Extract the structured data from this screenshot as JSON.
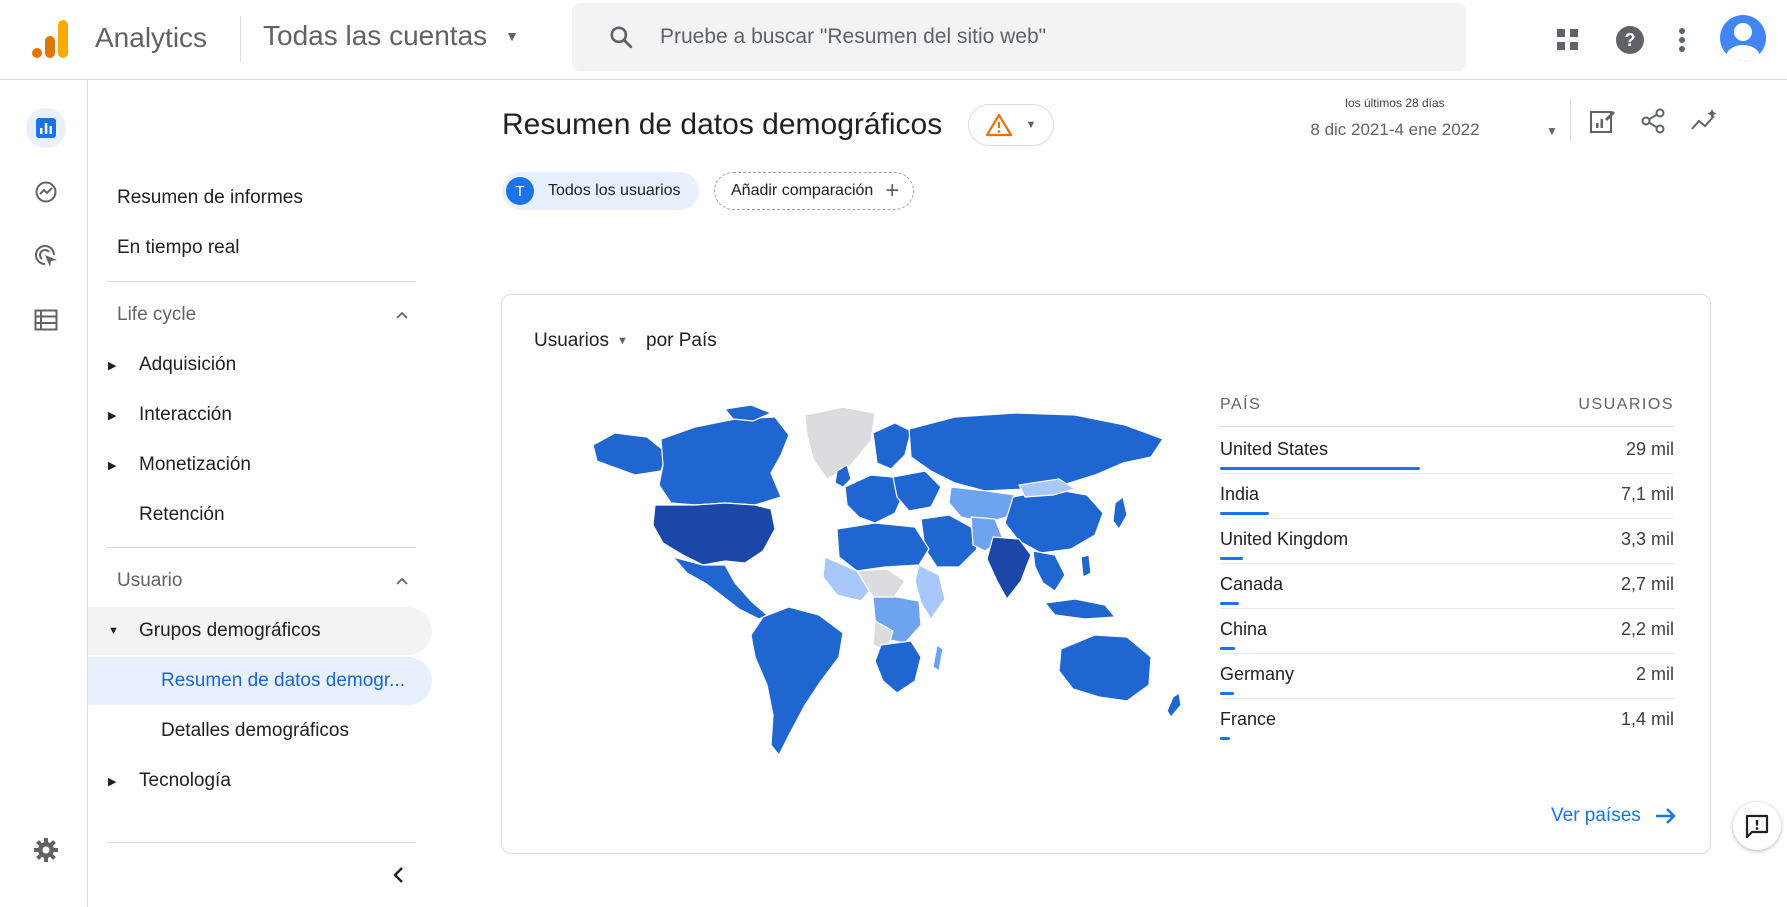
{
  "topbar": {
    "brand": "Analytics",
    "account": "Todas las cuentas",
    "search_placeholder": "Pruebe a buscar \"Resumen del sitio web\""
  },
  "sidenav": {
    "top_items": [
      "Resumen de informes",
      "En tiempo real"
    ],
    "lifecycle": {
      "title": "Life cycle",
      "items": [
        "Adquisición",
        "Interacción",
        "Monetización",
        "Retención"
      ]
    },
    "user": {
      "title": "Usuario",
      "group": "Grupos demográficos",
      "sub_items": [
        "Resumen de datos demogr...",
        "Detalles demográficos"
      ],
      "tech": "Tecnología"
    }
  },
  "header": {
    "title": "Resumen de datos demográficos",
    "date_caption": "los últimos 28 días",
    "date_range": "8 dic 2021-4 ene 2022"
  },
  "chips": {
    "user_badge": "T",
    "user_label": "Todos los usuarios",
    "add_label": "Añadir comparación"
  },
  "card": {
    "metric": "Usuarios",
    "dimension": "por País",
    "col_country": "PAÍS",
    "col_users": "USUARIOS",
    "see_all": "Ver países"
  },
  "colors": {
    "accent": "#1a73e8",
    "map_high": "#1e4fb5",
    "map_mid": "#1f66d0",
    "map_light": "#6ea3f0",
    "map_lighter": "#a8c7fa",
    "map_nodata": "#dadce0"
  },
  "chart_data": {
    "type": "table",
    "metric": "Usuarios",
    "dimension": "País",
    "rows": [
      {
        "country": "United States",
        "users_label": "29 mil",
        "users": 29000
      },
      {
        "country": "India",
        "users_label": "7,1 mil",
        "users": 7100
      },
      {
        "country": "United Kingdom",
        "users_label": "3,3 mil",
        "users": 3300
      },
      {
        "country": "Canada",
        "users_label": "2,7 mil",
        "users": 2700
      },
      {
        "country": "China",
        "users_label": "2,2 mil",
        "users": 2200
      },
      {
        "country": "Germany",
        "users_label": "2 mil",
        "users": 2000
      },
      {
        "country": "France",
        "users_label": "1,4 mil",
        "users": 1400
      }
    ]
  }
}
